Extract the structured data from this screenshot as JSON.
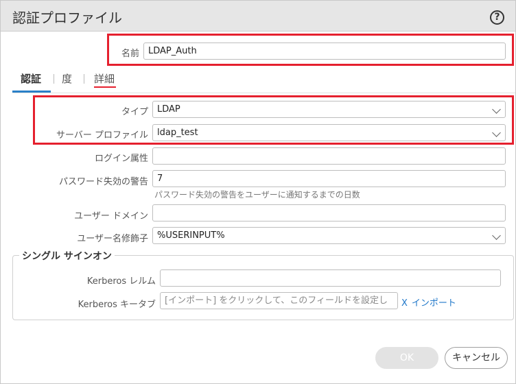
{
  "dialog": {
    "title": "認証プロファイル",
    "help_icon": "question-circle-icon"
  },
  "name_field": {
    "label": "名前",
    "value": "LDAP_Auth"
  },
  "tabs": [
    {
      "label": "認証",
      "active": true
    },
    {
      "label": "度",
      "active": false
    },
    {
      "label": "詳細",
      "active": false
    }
  ],
  "fields": {
    "type": {
      "label": "タイプ",
      "value": "LDAP"
    },
    "server_profile": {
      "label": "サーバー プロファイル",
      "value": "ldap_test"
    },
    "login_attr": {
      "label": "ログイン属性",
      "value": ""
    },
    "password_warning": {
      "label": "パスワード失効の警告",
      "value": "7",
      "hint": "パスワード失効の警告をユーザーに通知するまでの日数"
    },
    "user_domain": {
      "label": "ユーザー ドメイン",
      "value": ""
    },
    "username_modifier": {
      "label": "ユーザー名修飾子",
      "value": "%USERINPUT%"
    }
  },
  "sso": {
    "legend": "シングル サインオン",
    "kerberos_realm": {
      "label": "Kerberos レルム",
      "value": ""
    },
    "kerberos_keytab": {
      "label": "Kerberos キータブ",
      "placeholder": "[インポート] をクリックして、このフィールドを設定し"
    },
    "import_link": {
      "x": "X",
      "label": "インポート"
    }
  },
  "buttons": {
    "ok": "OK",
    "cancel": "キャンセル"
  },
  "colors": {
    "highlight": "#e5202e",
    "link": "#1f77c9",
    "tab_active": "#2a80c8"
  }
}
